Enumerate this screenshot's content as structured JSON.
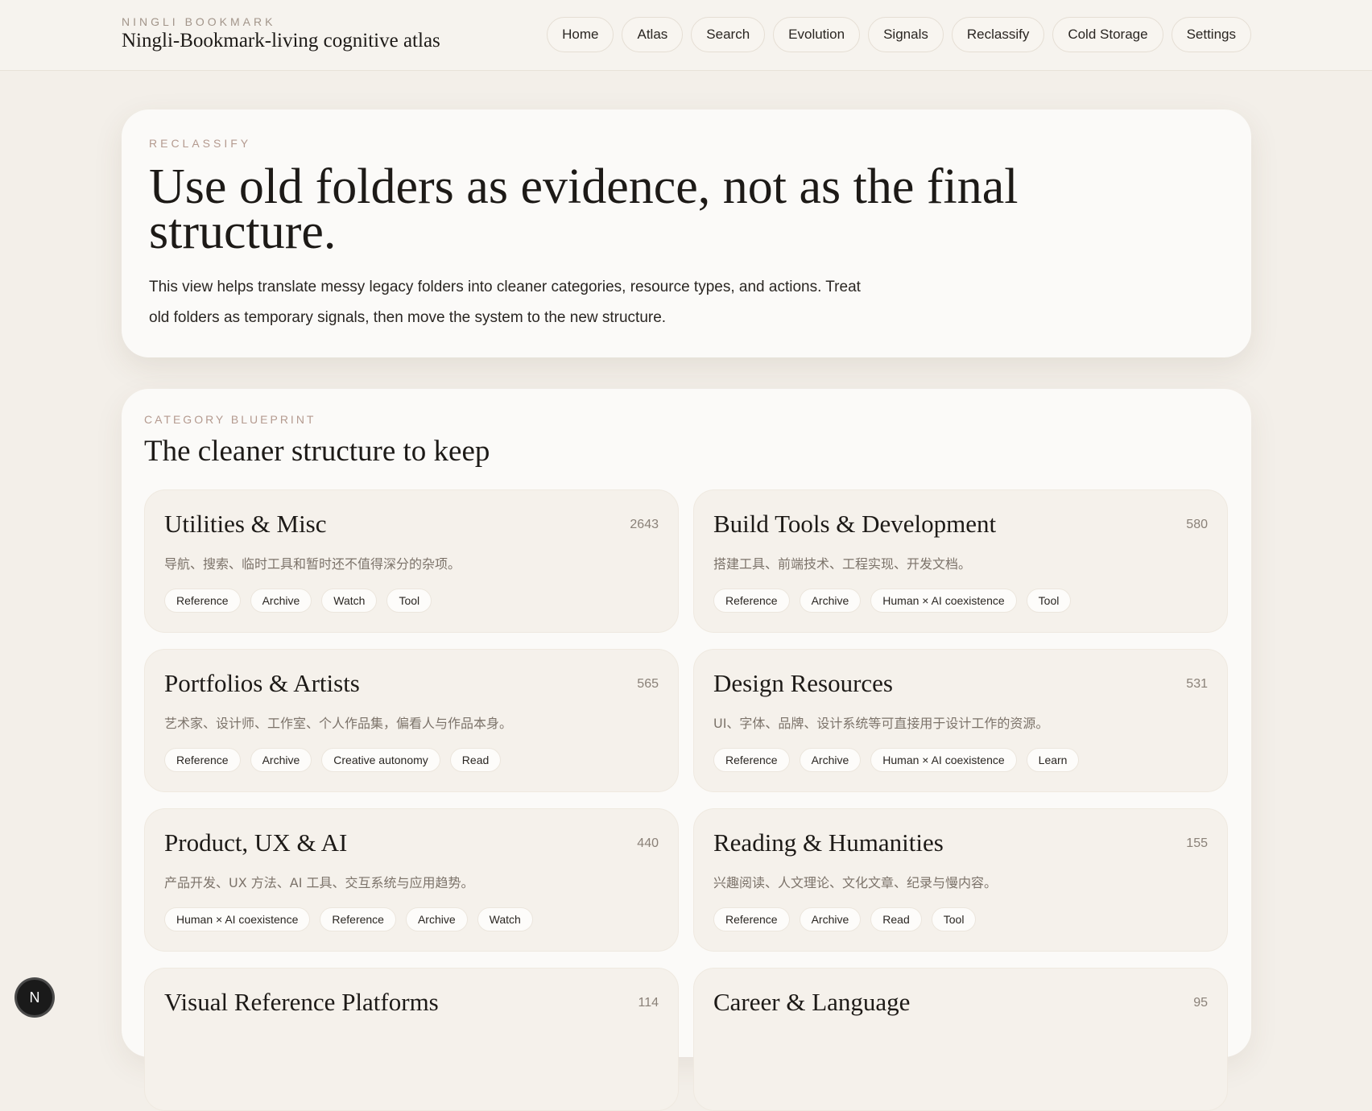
{
  "brand": {
    "kicker": "NINGLI BOOKMARK",
    "title": "Ningli-Bookmark-living cognitive atlas"
  },
  "nav": [
    {
      "label": "Home"
    },
    {
      "label": "Atlas"
    },
    {
      "label": "Search"
    },
    {
      "label": "Evolution"
    },
    {
      "label": "Signals"
    },
    {
      "label": "Reclassify"
    },
    {
      "label": "Cold Storage"
    },
    {
      "label": "Settings"
    }
  ],
  "hero": {
    "kicker": "RECLASSIFY",
    "title": "Use old folders as evidence, not as the final structure.",
    "description": "This view helps translate messy legacy folders into cleaner categories, resource types, and actions. Treat old folders as temporary signals, then move the system to the new structure."
  },
  "blueprint": {
    "kicker": "CATEGORY BLUEPRINT",
    "title": "The cleaner structure to keep",
    "cards": [
      {
        "title": "Utilities & Misc",
        "count": "2643",
        "description": "导航、搜索、临时工具和暂时还不值得深分的杂项。",
        "tags": [
          "Reference",
          "Archive",
          "Watch",
          "Tool"
        ]
      },
      {
        "title": "Build Tools & Development",
        "count": "580",
        "description": "搭建工具、前端技术、工程实现、开发文档。",
        "tags": [
          "Reference",
          "Archive",
          "Human × AI coexistence",
          "Tool"
        ]
      },
      {
        "title": "Portfolios & Artists",
        "count": "565",
        "description": "艺术家、设计师、工作室、个人作品集，偏看人与作品本身。",
        "tags": [
          "Reference",
          "Archive",
          "Creative autonomy",
          "Read"
        ]
      },
      {
        "title": "Design Resources",
        "count": "531",
        "description": "UI、字体、品牌、设计系统等可直接用于设计工作的资源。",
        "tags": [
          "Reference",
          "Archive",
          "Human × AI coexistence",
          "Learn"
        ]
      },
      {
        "title": "Product, UX & AI",
        "count": "440",
        "description": "产品开发、UX 方法、AI 工具、交互系统与应用趋势。",
        "tags": [
          "Human × AI coexistence",
          "Reference",
          "Archive",
          "Watch"
        ]
      },
      {
        "title": "Reading & Humanities",
        "count": "155",
        "description": "兴趣阅读、人文理论、文化文章、纪录与慢内容。",
        "tags": [
          "Reference",
          "Archive",
          "Read",
          "Tool"
        ]
      },
      {
        "title": "Visual Reference Platforms",
        "count": "114",
        "description": "",
        "tags": []
      },
      {
        "title": "Career & Language",
        "count": "95",
        "description": "",
        "tags": []
      }
    ]
  },
  "dev_badge": {
    "letter": "N"
  }
}
